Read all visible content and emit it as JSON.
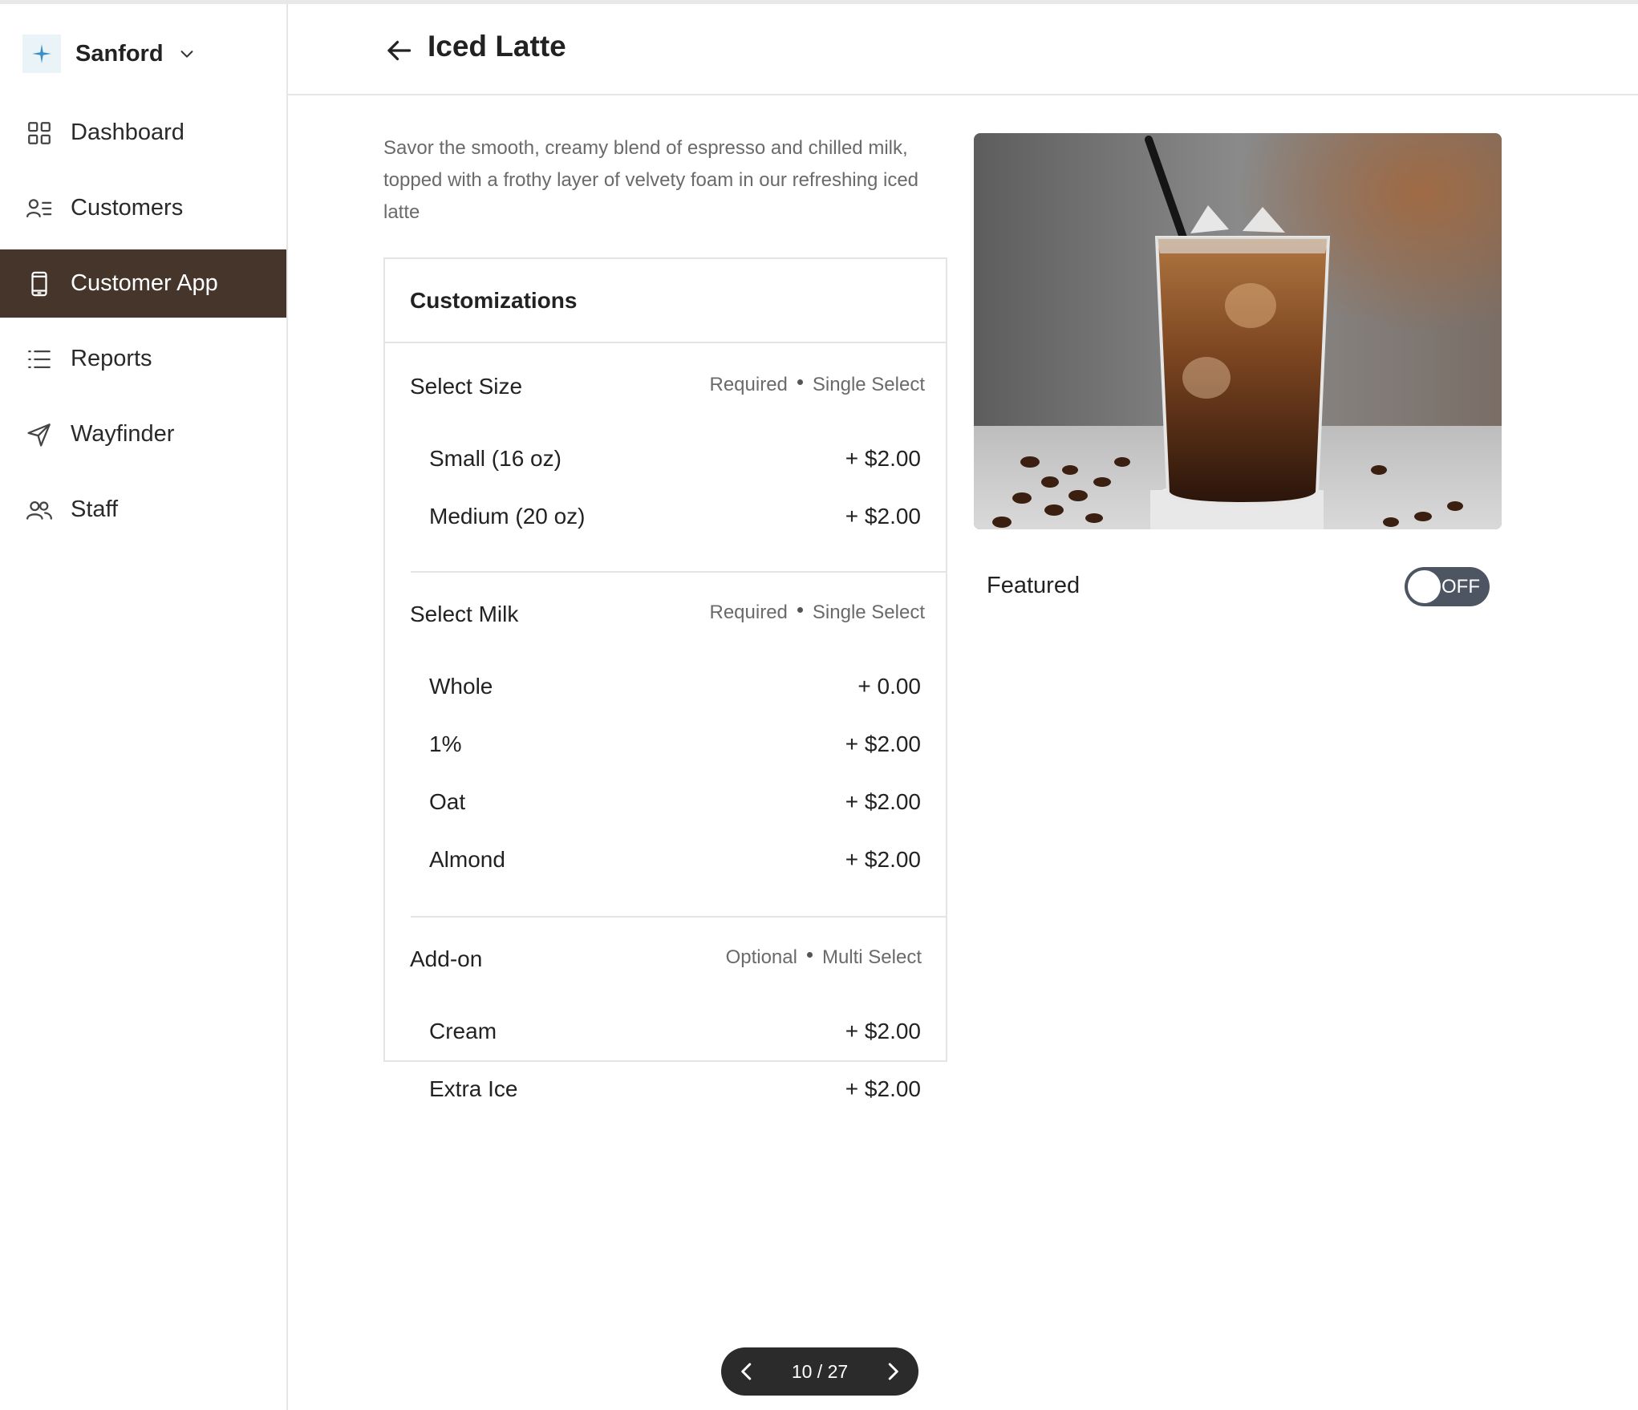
{
  "brand": {
    "name": "Sanford",
    "icon": "sparkle-icon"
  },
  "sidebar": {
    "items": [
      {
        "label": "Dashboard",
        "icon": "grid-icon",
        "active": false
      },
      {
        "label": "Customers",
        "icon": "user-list-icon",
        "active": false
      },
      {
        "label": "Customer App",
        "icon": "mobile-icon",
        "active": true
      },
      {
        "label": "Reports",
        "icon": "list-icon",
        "active": false
      },
      {
        "label": "Wayfinder",
        "icon": "navigation-arrow-icon",
        "active": false
      },
      {
        "label": "Staff",
        "icon": "users-icon",
        "active": false
      }
    ]
  },
  "header": {
    "title": "Iced Latte"
  },
  "product": {
    "description": "Savor the smooth, creamy blend of espresso and chilled milk, topped with a frothy layer of velvety foam in our refreshing iced latte",
    "featured_label": "Featured",
    "featured_state": "OFF"
  },
  "customizations": {
    "title": "Customizations",
    "groups": [
      {
        "title": "Select Size",
        "requirement": "Required",
        "selection": "Single Select",
        "options": [
          {
            "name": "Small (16 oz)",
            "price": "+ $2.00"
          },
          {
            "name": "Medium (20 oz)",
            "price": "+ $2.00"
          }
        ]
      },
      {
        "title": "Select Milk",
        "requirement": "Required",
        "selection": "Single Select",
        "options": [
          {
            "name": "Whole",
            "price": "+ 0.00"
          },
          {
            "name": "1%",
            "price": "+ $2.00"
          },
          {
            "name": "Oat",
            "price": "+ $2.00"
          },
          {
            "name": "Almond",
            "price": "+ $2.00"
          }
        ]
      },
      {
        "title": "Add-on",
        "requirement": "Optional",
        "selection": "Multi Select",
        "options": [
          {
            "name": "Cream",
            "price": "+ $2.00"
          },
          {
            "name": "Extra Ice",
            "price": "+ $2.00"
          }
        ]
      }
    ]
  },
  "pager": {
    "text": "10 / 27"
  },
  "colors": {
    "active_nav": "#45352a",
    "toggle_off": "#4d5563",
    "pager_bg": "#2b2b2b",
    "brand_accent": "#3a8fc4"
  }
}
